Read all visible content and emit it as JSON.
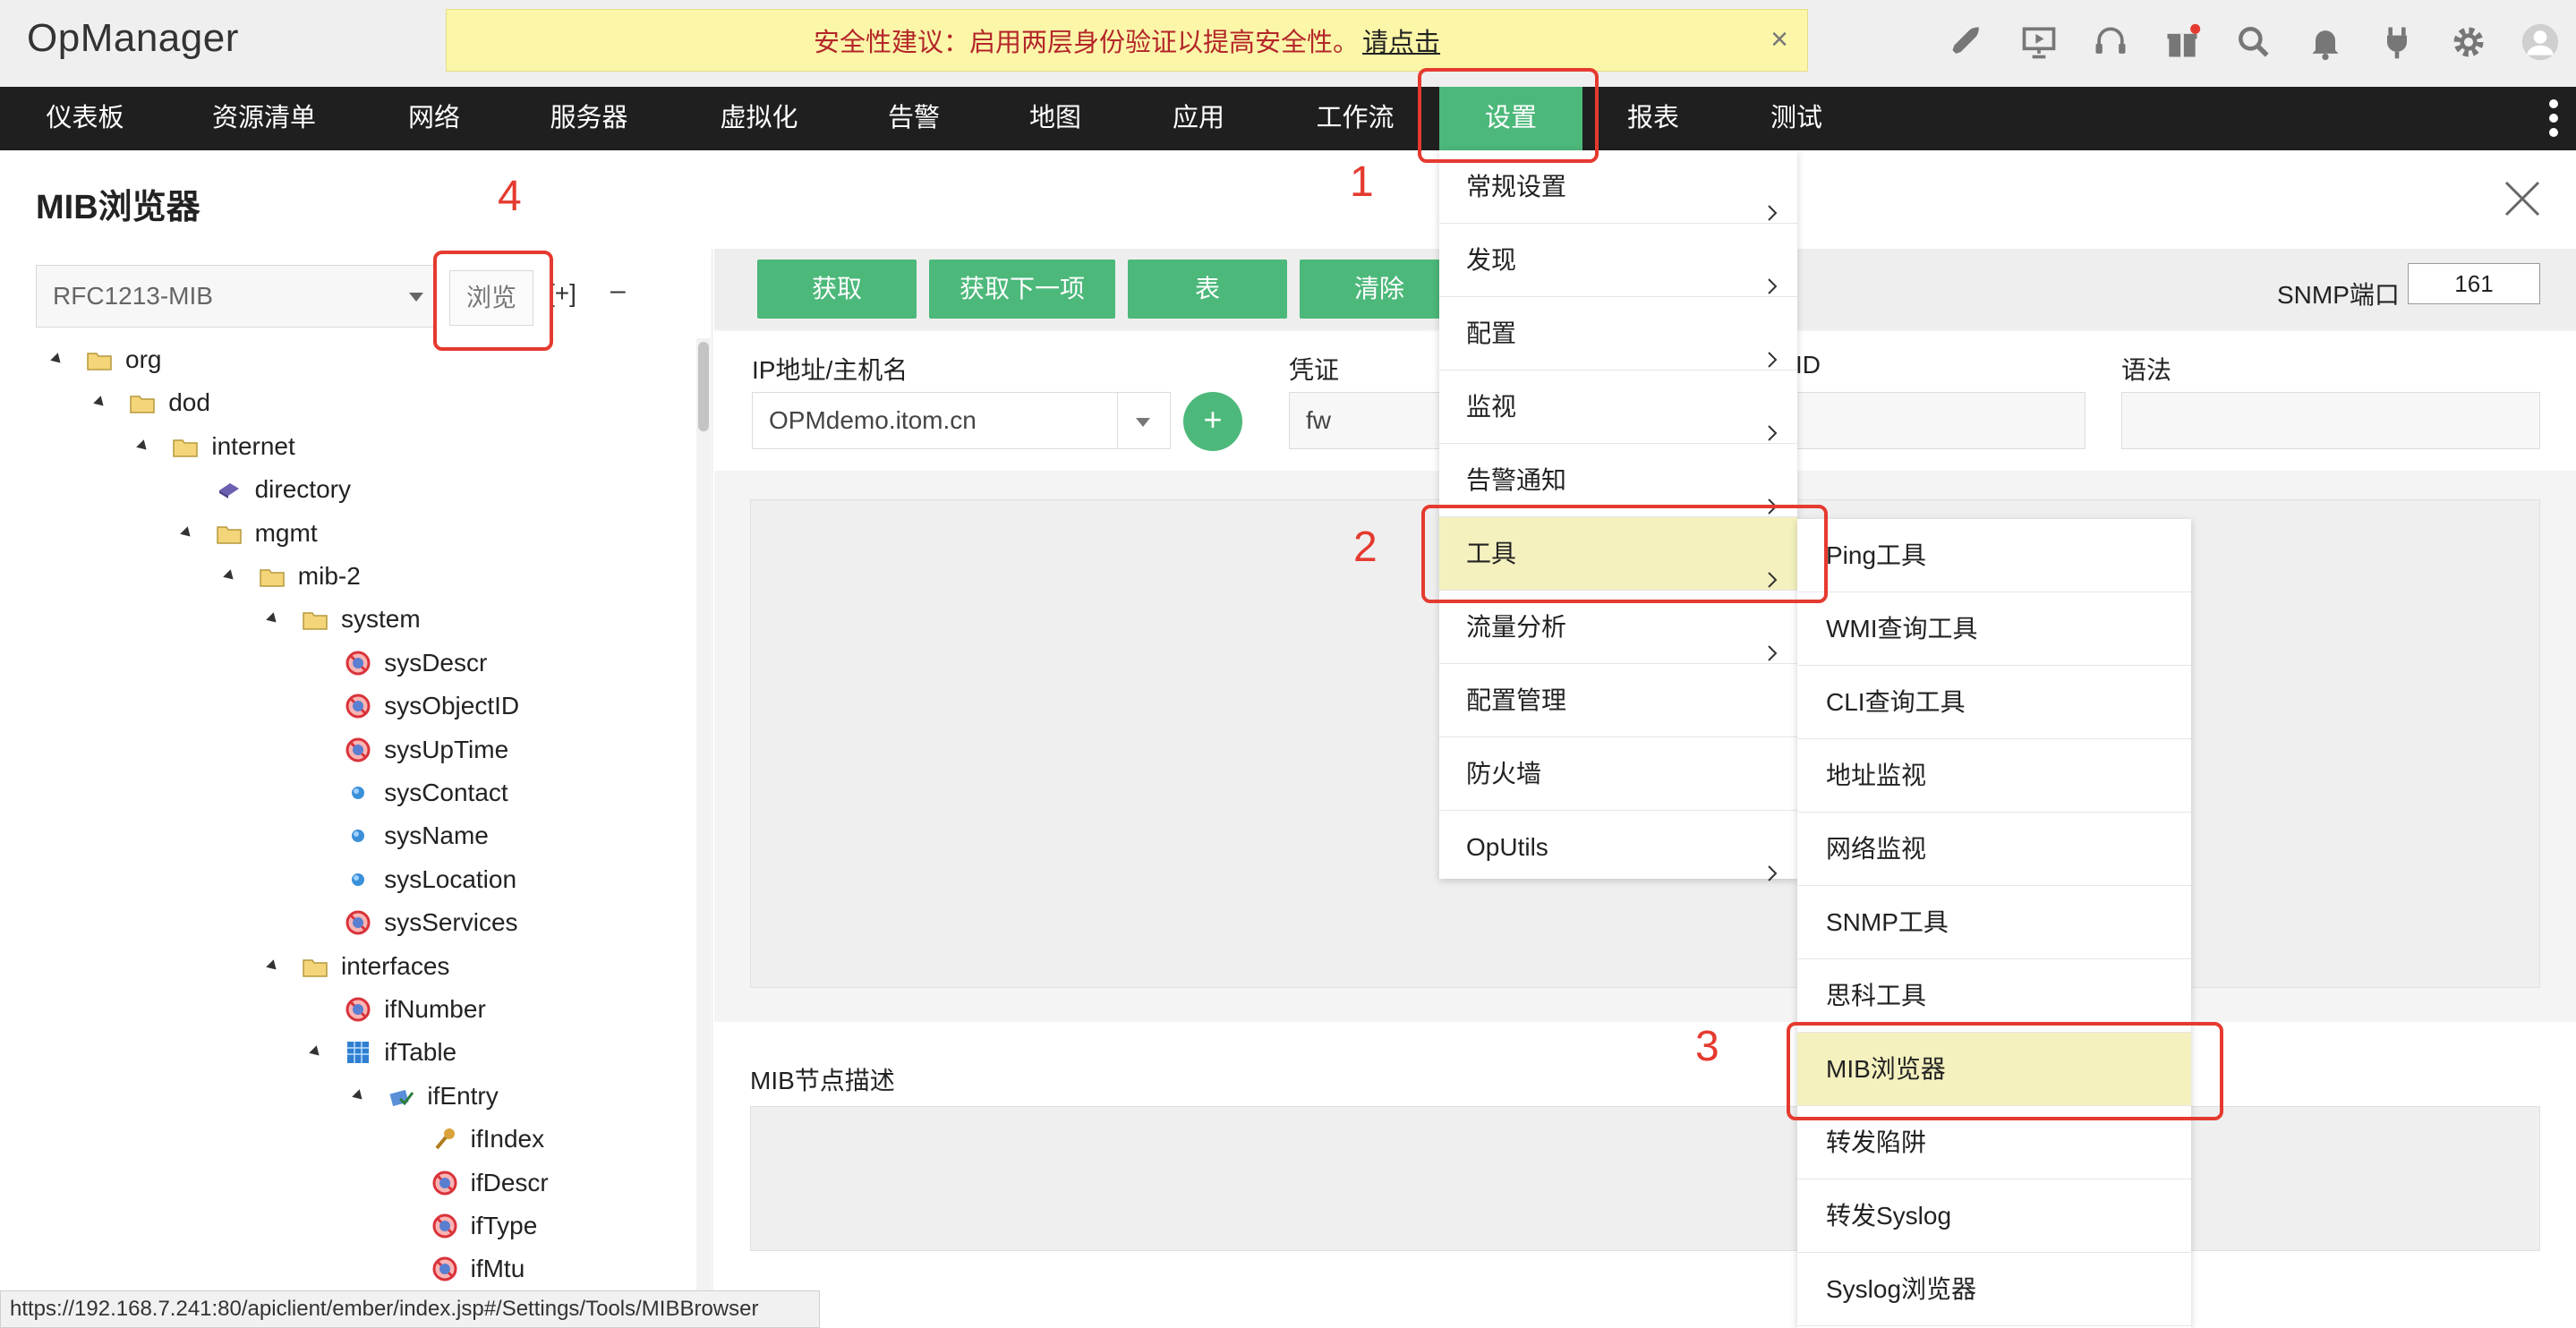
{
  "app": {
    "brand": "OpManager"
  },
  "banner": {
    "text": "安全性建议：启用两层身份验证以提高安全性。",
    "link": "请点击"
  },
  "header_icons": [
    "rocket-icon",
    "presentation-icon",
    "headset-icon",
    "gift-icon",
    "search-icon",
    "bell-icon",
    "plug-icon",
    "gear-icon",
    "avatar-icon"
  ],
  "nav": {
    "items": [
      "仪表板",
      "资源清单",
      "网络",
      "服务器",
      "虚拟化",
      "告警",
      "地图",
      "应用",
      "工作流",
      "设置",
      "报表",
      "测试"
    ],
    "active": "设置"
  },
  "page": {
    "title": "MIB浏览器"
  },
  "left": {
    "mib_select": "RFC1213-MIB",
    "browse_label": "浏览",
    "expand_label": "[+]",
    "collapse_label": "–",
    "tree": [
      {
        "label": "org",
        "level": 0,
        "expander": true,
        "icon": "folder-icon"
      },
      {
        "label": "dod",
        "level": 1,
        "expander": true,
        "icon": "folder-icon"
      },
      {
        "label": "internet",
        "level": 2,
        "expander": true,
        "icon": "folder-icon"
      },
      {
        "label": "directory",
        "level": 3,
        "expander": false,
        "icon": "book-icon"
      },
      {
        "label": "mgmt",
        "level": 3,
        "expander": true,
        "icon": "folder-icon"
      },
      {
        "label": "mib-2",
        "level": 4,
        "expander": true,
        "icon": "folder-icon"
      },
      {
        "label": "system",
        "level": 5,
        "expander": true,
        "icon": "folder-icon"
      },
      {
        "label": "sysDescr",
        "level": 6,
        "expander": false,
        "icon": "no-access-icon"
      },
      {
        "label": "sysObjectID",
        "level": 6,
        "expander": false,
        "icon": "no-access-icon"
      },
      {
        "label": "sysUpTime",
        "level": 6,
        "expander": false,
        "icon": "no-access-icon"
      },
      {
        "label": "sysContact",
        "level": 6,
        "expander": false,
        "icon": "dot-icon"
      },
      {
        "label": "sysName",
        "level": 6,
        "expander": false,
        "icon": "dot-icon"
      },
      {
        "label": "sysLocation",
        "level": 6,
        "expander": false,
        "icon": "dot-icon"
      },
      {
        "label": "sysServices",
        "level": 6,
        "expander": false,
        "icon": "no-access-icon"
      },
      {
        "label": "interfaces",
        "level": 5,
        "expander": true,
        "icon": "folder-icon"
      },
      {
        "label": "ifNumber",
        "level": 6,
        "expander": false,
        "icon": "no-access-icon"
      },
      {
        "label": "ifTable",
        "level": 6,
        "expander": true,
        "icon": "table-icon"
      },
      {
        "label": "ifEntry",
        "level": 7,
        "expander": true,
        "icon": "entry-icon"
      },
      {
        "label": "ifIndex",
        "level": 8,
        "expander": false,
        "icon": "key-icon"
      },
      {
        "label": "ifDescr",
        "level": 8,
        "expander": false,
        "icon": "no-access-icon"
      },
      {
        "label": "ifType",
        "level": 8,
        "expander": false,
        "icon": "no-access-icon"
      },
      {
        "label": "ifMtu",
        "level": 8,
        "expander": false,
        "icon": "no-access-icon"
      }
    ]
  },
  "toolbar": {
    "buttons": [
      "获取",
      "获取下一项",
      "表",
      "清除"
    ],
    "snmp_port_label": "SNMP端口",
    "snmp_port_value": "161"
  },
  "form": {
    "host_label": "IP地址/主机名",
    "host_value": "OPMdemo.itom.cn",
    "add_label": "+",
    "cred_label": "凭证",
    "cred_value": "fw",
    "oid_label": "ID",
    "syntax_label": "语法"
  },
  "desc": {
    "label": "MIB节点描述"
  },
  "settings_menu": {
    "items": [
      {
        "label": "常规设置",
        "has_sub": true
      },
      {
        "label": "发现",
        "has_sub": true
      },
      {
        "label": "配置",
        "has_sub": true
      },
      {
        "label": "监视",
        "has_sub": true
      },
      {
        "label": "告警通知",
        "has_sub": true
      },
      {
        "label": "工具",
        "has_sub": true,
        "highlight": true
      },
      {
        "label": "流量分析",
        "has_sub": true
      },
      {
        "label": "配置管理",
        "has_sub": false
      },
      {
        "label": "防火墙",
        "has_sub": false
      },
      {
        "label": "OpUtils",
        "has_sub": true
      }
    ]
  },
  "tools_menu": {
    "items": [
      {
        "label": "Ping工具"
      },
      {
        "label": "WMI查询工具"
      },
      {
        "label": "CLI查询工具"
      },
      {
        "label": "地址监视"
      },
      {
        "label": "网络监视"
      },
      {
        "label": "SNMP工具"
      },
      {
        "label": "思科工具"
      },
      {
        "label": "MIB浏览器",
        "highlight": true
      },
      {
        "label": "转发陷阱"
      },
      {
        "label": "转发Syslog"
      },
      {
        "label": "Syslog浏览器"
      }
    ]
  },
  "annotations": [
    "1",
    "2",
    "3",
    "4"
  ],
  "status_url": "https://192.168.7.241:80/apiclient/ember/index.jsp#/Settings/Tools/MIBBrowser",
  "colors": {
    "accent": "#4cb87a",
    "nav_bg": "#1f1f1f",
    "annotation": "#e53a2f",
    "highlight": "#f4f1bf"
  }
}
